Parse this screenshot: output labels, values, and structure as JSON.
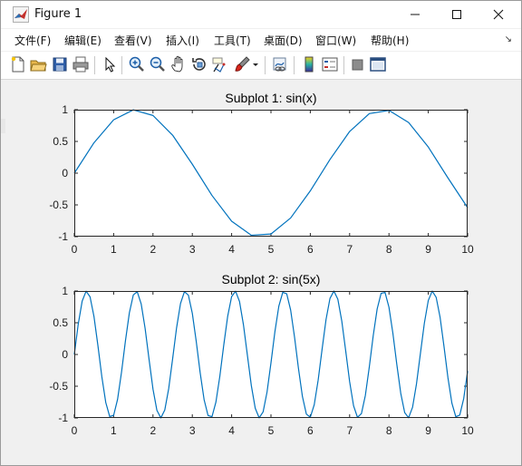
{
  "window": {
    "title": "Figure 1",
    "icon": "matlab-icon"
  },
  "menu": {
    "items": [
      {
        "label": "文件(F)",
        "name": "menu-file"
      },
      {
        "label": "编辑(E)",
        "name": "menu-edit"
      },
      {
        "label": "查看(V)",
        "name": "menu-view"
      },
      {
        "label": "插入(I)",
        "name": "menu-insert"
      },
      {
        "label": "工具(T)",
        "name": "menu-tools"
      },
      {
        "label": "桌面(D)",
        "name": "menu-desktop"
      },
      {
        "label": "窗口(W)",
        "name": "menu-window"
      },
      {
        "label": "帮助(H)",
        "name": "menu-help"
      }
    ],
    "overflow_icon": "toolbar-dock-arrow-icon"
  },
  "toolbar": {
    "buttons": [
      "new-figure-icon",
      "open-file-icon",
      "save-icon",
      "print-icon",
      "edit-plot-pointer-icon",
      "zoom-in-icon",
      "zoom-out-icon",
      "pan-icon",
      "rotate-3d-icon",
      "data-cursor-icon",
      "brush-icon",
      "brush-dropdown-icon",
      "link-plot-icon",
      "insert-colorbar-icon",
      "insert-legend-icon",
      "hide-plot-tools-icon",
      "show-plot-tools-icon"
    ]
  },
  "colors": {
    "line": "#0072BD",
    "axes_bg": "#ffffff",
    "figure_bg": "#f0f0f0"
  },
  "chart_data": [
    {
      "type": "line",
      "title": "Subplot 1: sin(x)",
      "function": "sin(x)",
      "xlabel": "",
      "ylabel": "",
      "xlim": [
        0,
        10
      ],
      "ylim": [
        -1,
        1
      ],
      "xticks": [
        0,
        1,
        2,
        3,
        4,
        5,
        6,
        7,
        8,
        9,
        10
      ],
      "yticks": [
        -1,
        -0.5,
        0,
        0.5,
        1
      ],
      "ytick_labels": [
        "-1",
        "-0.5",
        "0",
        "0.5",
        "1"
      ],
      "grid": false,
      "series": [
        {
          "x": [
            0,
            0.5,
            1,
            1.5,
            2,
            2.5,
            3,
            3.5,
            4,
            4.5,
            5,
            5.5,
            6,
            6.5,
            7,
            7.5,
            8,
            8.5,
            9,
            9.5,
            10
          ],
          "y": [
            0,
            0.479,
            0.841,
            0.997,
            0.909,
            0.598,
            0.141,
            -0.351,
            -0.757,
            -0.978,
            -0.959,
            -0.706,
            -0.279,
            0.215,
            0.657,
            0.938,
            0.989,
            0.798,
            0.412,
            -0.075,
            -0.544
          ]
        }
      ]
    },
    {
      "type": "line",
      "title": "Subplot 2: sin(5x)",
      "function": "sin(5x)",
      "xlabel": "",
      "ylabel": "",
      "xlim": [
        0,
        10
      ],
      "ylim": [
        -1,
        1
      ],
      "xticks": [
        0,
        1,
        2,
        3,
        4,
        5,
        6,
        7,
        8,
        9,
        10
      ],
      "yticks": [
        -1,
        -0.5,
        0,
        0.5,
        1
      ],
      "ytick_labels": [
        "-1",
        "-0.5",
        "0",
        "0.5",
        "1"
      ],
      "grid": false,
      "series": [
        {
          "x": [
            0,
            0.1,
            0.2,
            0.3,
            0.4,
            0.5,
            0.6,
            0.7,
            0.8,
            0.9,
            1.0,
            1.1,
            1.2,
            1.3,
            1.4,
            1.5,
            1.6,
            1.7,
            1.8,
            1.9,
            2.0,
            2.1,
            2.2,
            2.3,
            2.4,
            2.5,
            2.6,
            2.7,
            2.8,
            2.9,
            3.0,
            3.1,
            3.2,
            3.3,
            3.4,
            3.5,
            3.6,
            3.7,
            3.8,
            3.9,
            4.0,
            4.1,
            4.2,
            4.3,
            4.4,
            4.5,
            4.6,
            4.7,
            4.8,
            4.9,
            5.0,
            5.1,
            5.2,
            5.3,
            5.4,
            5.5,
            5.6,
            5.7,
            5.8,
            5.9,
            6.0,
            6.1,
            6.2,
            6.3,
            6.4,
            6.5,
            6.6,
            6.7,
            6.8,
            6.9,
            7.0,
            7.1,
            7.2,
            7.3,
            7.4,
            7.5,
            7.6,
            7.7,
            7.8,
            7.9,
            8.0,
            8.1,
            8.2,
            8.3,
            8.4,
            8.5,
            8.6,
            8.7,
            8.8,
            8.9,
            9.0,
            9.1,
            9.2,
            9.3,
            9.4,
            9.5,
            9.6,
            9.7,
            9.8,
            9.9,
            10.0
          ],
          "y": [
            0,
            0.479,
            0.841,
            0.997,
            0.909,
            0.598,
            0.141,
            -0.351,
            -0.757,
            -0.978,
            -0.959,
            -0.706,
            -0.279,
            0.215,
            0.657,
            0.938,
            0.989,
            0.798,
            0.412,
            -0.075,
            -0.544,
            -0.88,
            -0.999,
            -0.875,
            -0.537,
            -0.066,
            0.42,
            0.803,
            0.99,
            0.935,
            0.65,
            0.206,
            -0.288,
            -0.712,
            -0.961,
            -0.98,
            -0.751,
            -0.342,
            0.15,
            0.604,
            0.913,
            0.997,
            0.836,
            0.47,
            -0.009,
            -0.487,
            -0.846,
            -0.998,
            -0.905,
            -0.592,
            -0.132,
            0.359,
            0.762,
            0.98,
            0.957,
            0.701,
            0.27,
            -0.224,
            -0.663,
            -0.94,
            -0.988,
            -0.792,
            -0.403,
            0.084,
            0.551,
            0.883,
            0.999,
            0.871,
            0.529,
            0.057,
            -0.428,
            -0.808,
            -0.991,
            -0.932,
            -0.644,
            -0.197,
            0.297,
            0.718,
            0.963,
            0.978,
            0.745,
            0.333,
            -0.159,
            -0.612,
            -0.916,
            -0.996,
            -0.831,
            -0.462,
            0.018,
            0.494,
            0.851,
            0.999,
            0.901,
            0.585,
            0.123,
            -0.368,
            -0.767,
            -0.981,
            -0.955,
            -0.696,
            -0.262
          ]
        }
      ]
    }
  ]
}
